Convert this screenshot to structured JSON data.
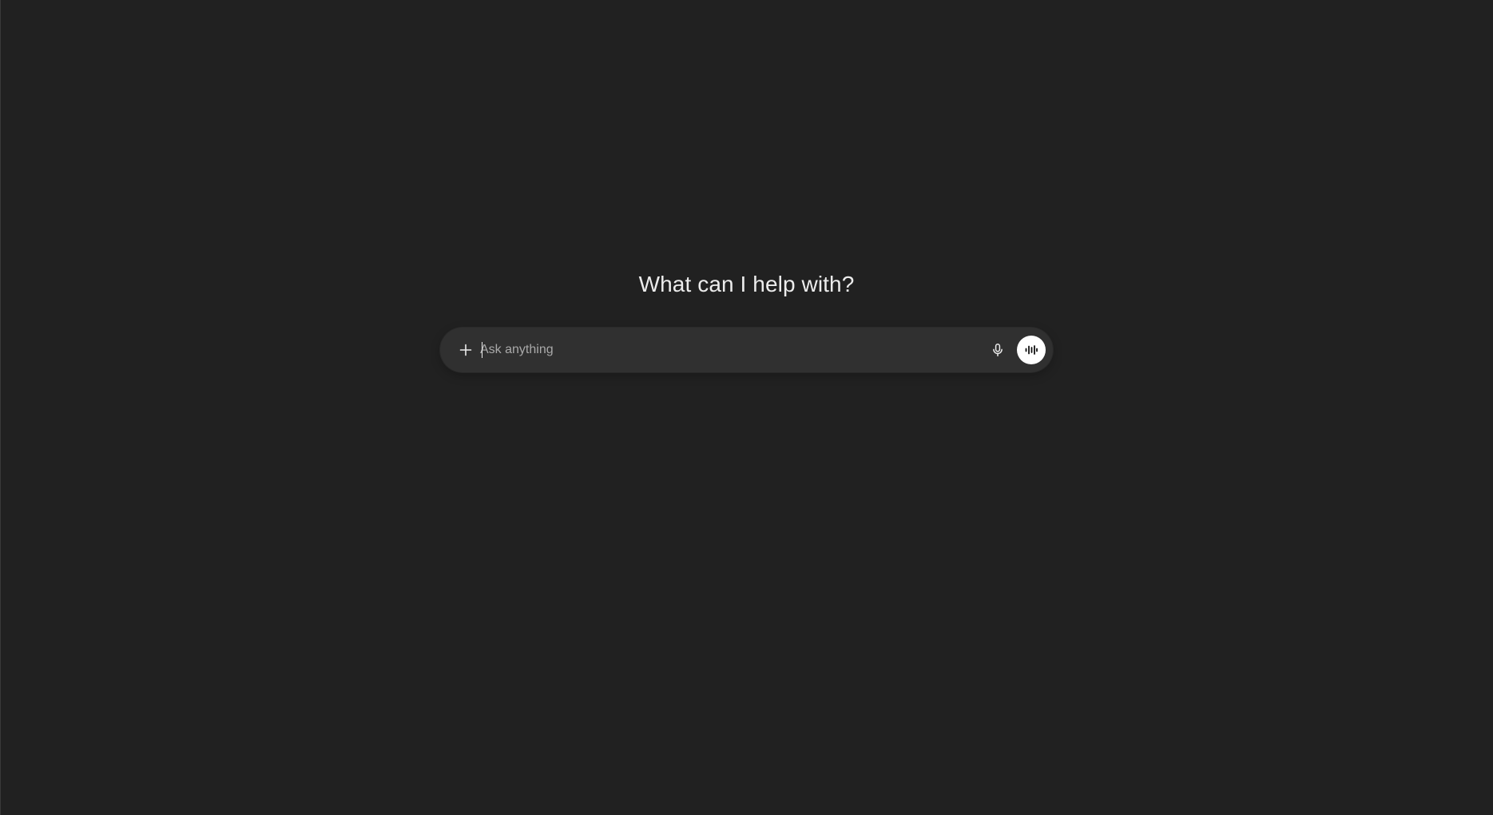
{
  "main": {
    "heading": "What can I help with?"
  },
  "composer": {
    "placeholder": "Ask anything",
    "value": "",
    "add_icon": "plus-icon",
    "mic_icon": "microphone-icon",
    "voice_icon": "voice-waveform-icon"
  },
  "colors": {
    "background": "#212121",
    "composer_background": "#303030",
    "text": "#ececec",
    "placeholder": "#a9a9a9",
    "voice_button": "#ffffff"
  }
}
